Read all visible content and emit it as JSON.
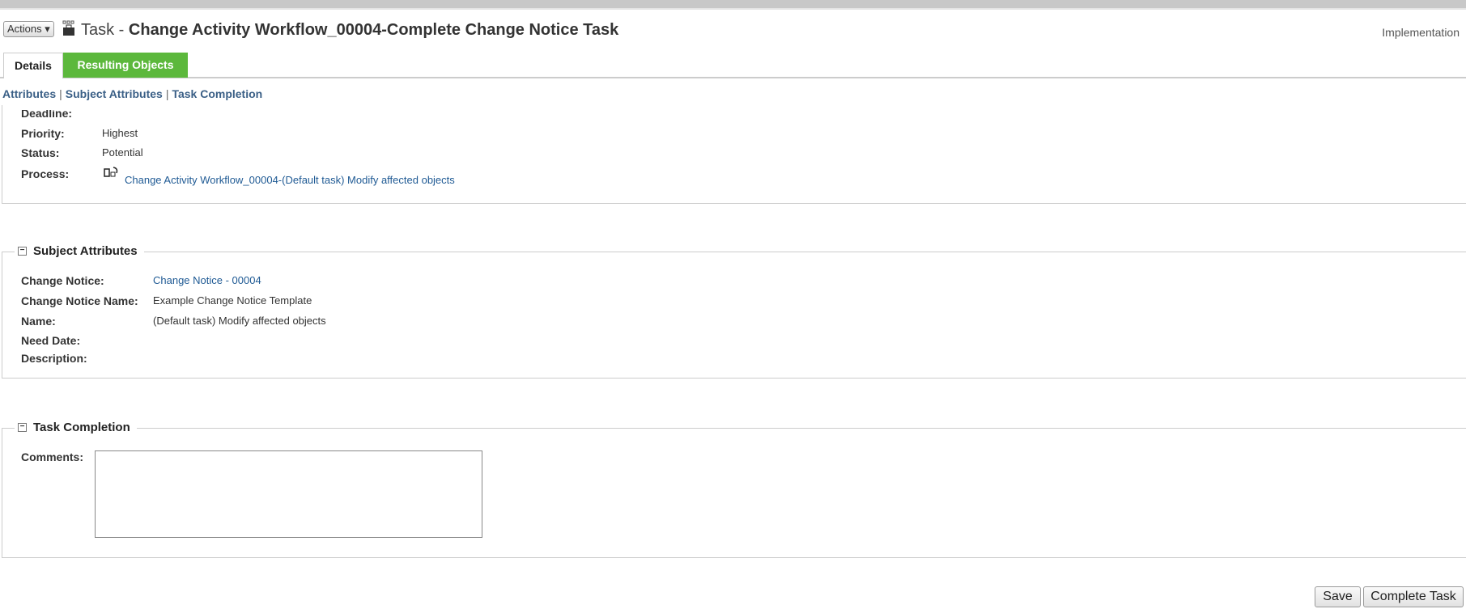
{
  "header": {
    "actions_label": "Actions",
    "title_prefix": "Task - ",
    "title": "Change Activity Workflow_00004-Complete Change Notice Task",
    "context": "Implementation"
  },
  "tabs": [
    {
      "label": "Details"
    },
    {
      "label": "Resulting Objects"
    }
  ],
  "section_links": [
    "Attributes",
    "Subject Attributes",
    "Task Completion"
  ],
  "attributes": {
    "deadline_label": "Deadline:",
    "priority_label": "Priority:",
    "priority": "Highest",
    "status_label": "Status:",
    "status": "Potential",
    "process_label": "Process:",
    "process": "Change Activity Workflow_00004-(Default task) Modify affected objects"
  },
  "subject": {
    "title": "Subject Attributes",
    "change_notice_label": "Change Notice:",
    "change_notice": "Change Notice - 00004",
    "cn_name_label": "Change Notice Name:",
    "cn_name": "Example Change Notice Template",
    "name_label": "Name:",
    "name": "(Default task) Modify affected objects",
    "need_date_label": "Need Date:",
    "description_label": "Description:"
  },
  "completion": {
    "title": "Task Completion",
    "comments_label": "Comments:",
    "comments": ""
  },
  "buttons": {
    "save": "Save",
    "complete": "Complete Task"
  },
  "colors": {
    "tab_active": "#5cb83c",
    "link": "#1f5a94"
  }
}
